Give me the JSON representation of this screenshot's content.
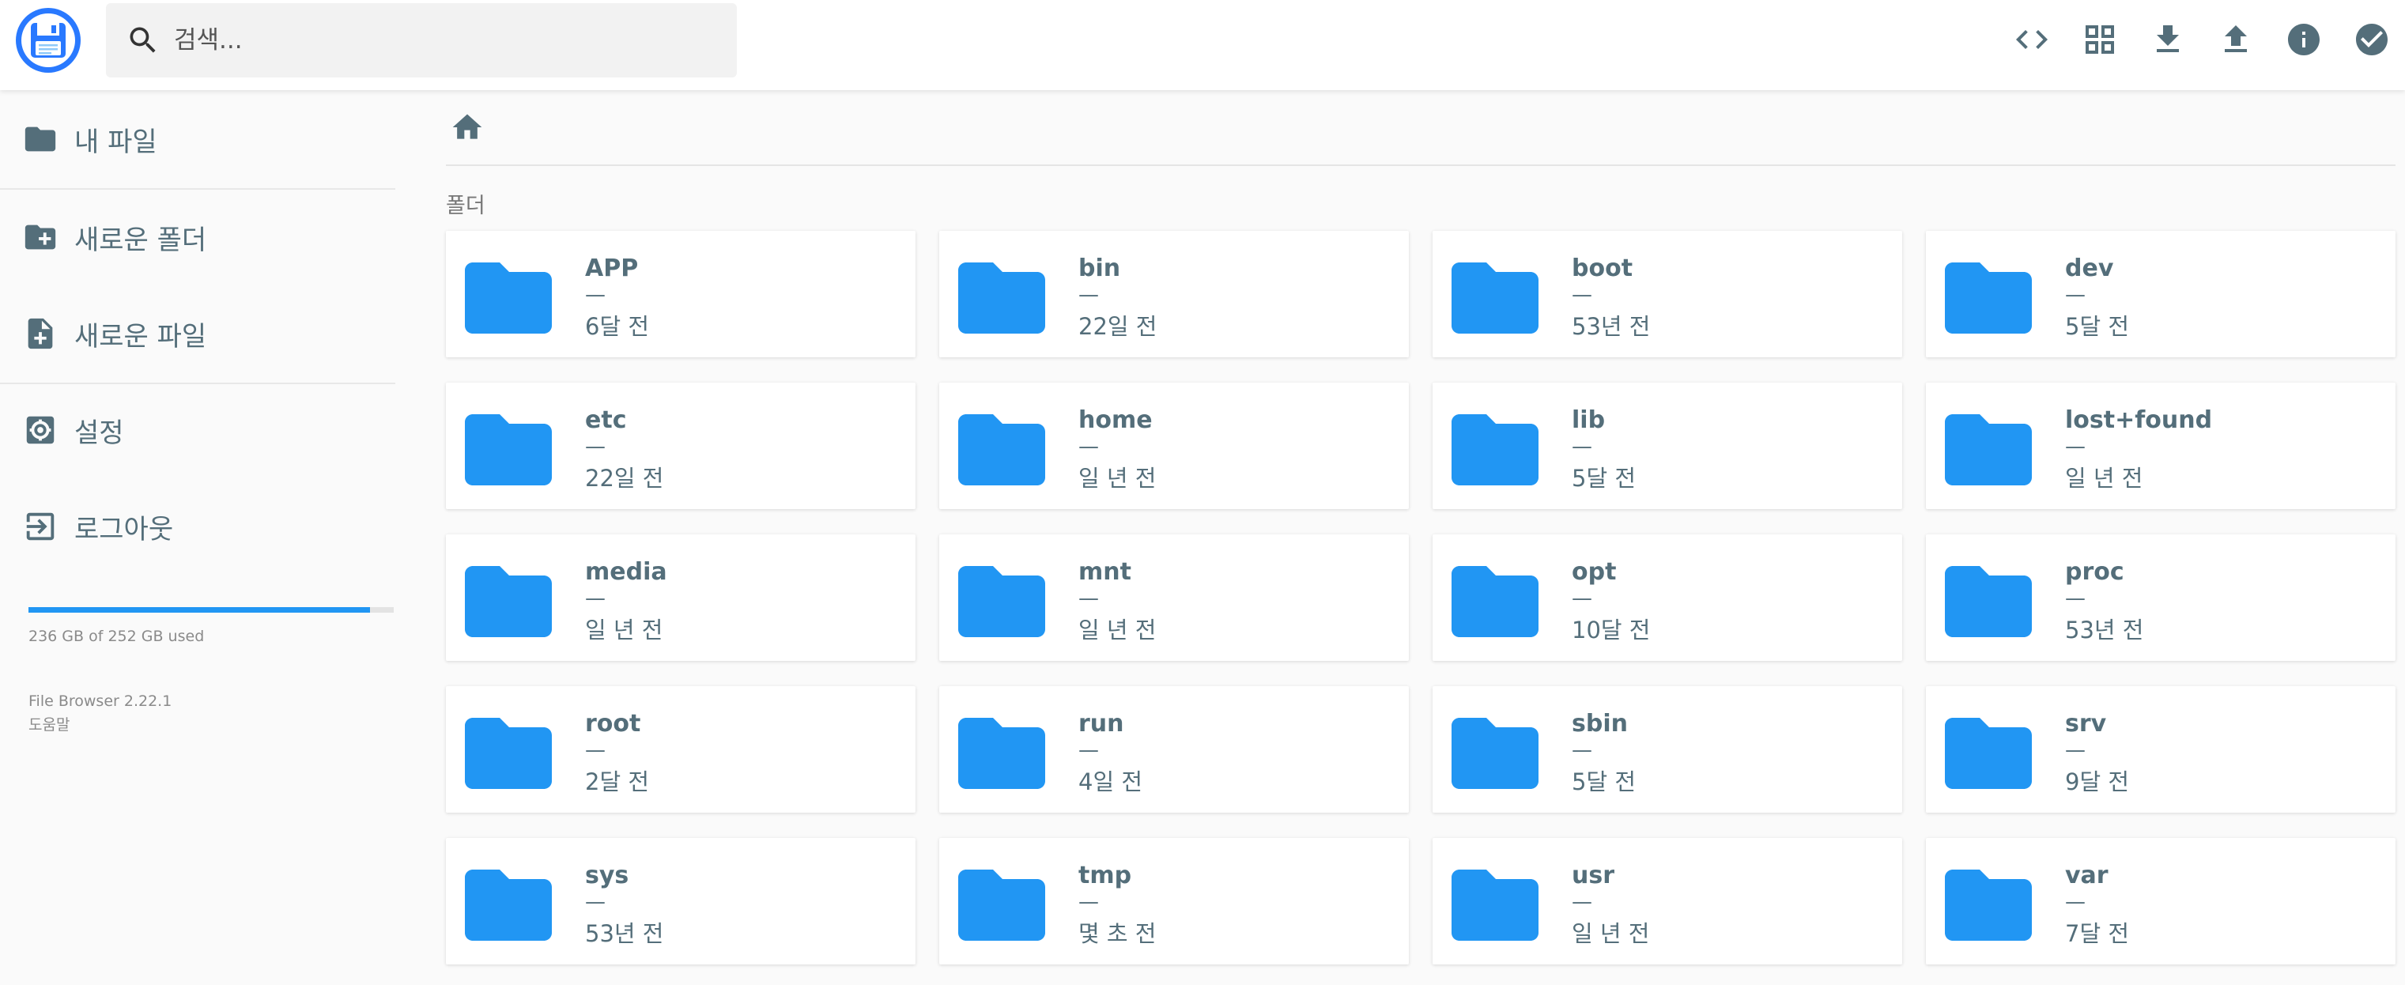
{
  "header": {
    "search_placeholder": "검색...",
    "actions": [
      {
        "name": "code-icon-button",
        "icon": "code-icon"
      },
      {
        "name": "grid-view-button",
        "icon": "grid-icon"
      },
      {
        "name": "download-button",
        "icon": "download-icon"
      },
      {
        "name": "upload-button",
        "icon": "upload-icon"
      },
      {
        "name": "info-button",
        "icon": "info-icon"
      },
      {
        "name": "select-button",
        "icon": "check-circle-icon"
      }
    ]
  },
  "sidebar": {
    "items": [
      {
        "label": "내 파일",
        "icon": "folder-icon"
      },
      {
        "label": "새로운 폴더",
        "icon": "create-new-folder-icon"
      },
      {
        "label": "새로운 파일",
        "icon": "note-add-icon"
      },
      {
        "label": "설정",
        "icon": "settings-icon"
      },
      {
        "label": "로그아웃",
        "icon": "exit-icon"
      }
    ],
    "usage": {
      "text": "236 GB of 252 GB used",
      "fraction": 0.936
    },
    "version": "File Browser 2.22.1",
    "help": "도움말"
  },
  "main": {
    "breadcrumb_icon": "home-icon",
    "section_title": "폴더",
    "folders": [
      {
        "name": "APP",
        "size": "—",
        "modified": "6달 전"
      },
      {
        "name": "bin",
        "size": "—",
        "modified": "22일 전"
      },
      {
        "name": "boot",
        "size": "—",
        "modified": "53년 전"
      },
      {
        "name": "dev",
        "size": "—",
        "modified": "5달 전"
      },
      {
        "name": "etc",
        "size": "—",
        "modified": "22일 전"
      },
      {
        "name": "home",
        "size": "—",
        "modified": "일 년 전"
      },
      {
        "name": "lib",
        "size": "—",
        "modified": "5달 전"
      },
      {
        "name": "lost+found",
        "size": "—",
        "modified": "일 년 전"
      },
      {
        "name": "media",
        "size": "—",
        "modified": "일 년 전"
      },
      {
        "name": "mnt",
        "size": "—",
        "modified": "일 년 전"
      },
      {
        "name": "opt",
        "size": "—",
        "modified": "10달 전"
      },
      {
        "name": "proc",
        "size": "—",
        "modified": "53년 전"
      },
      {
        "name": "root",
        "size": "—",
        "modified": "2달 전"
      },
      {
        "name": "run",
        "size": "—",
        "modified": "4일 전"
      },
      {
        "name": "sbin",
        "size": "—",
        "modified": "5달 전"
      },
      {
        "name": "srv",
        "size": "—",
        "modified": "9달 전"
      },
      {
        "name": "sys",
        "size": "—",
        "modified": "53년 전"
      },
      {
        "name": "tmp",
        "size": "—",
        "modified": "몇 초 전"
      },
      {
        "name": "usr",
        "size": "—",
        "modified": "일 년 전"
      },
      {
        "name": "var",
        "size": "—",
        "modified": "7달 전"
      }
    ]
  },
  "colors": {
    "accent": "#2196f3",
    "logo": "#2979ff",
    "text": "#546e7a"
  }
}
